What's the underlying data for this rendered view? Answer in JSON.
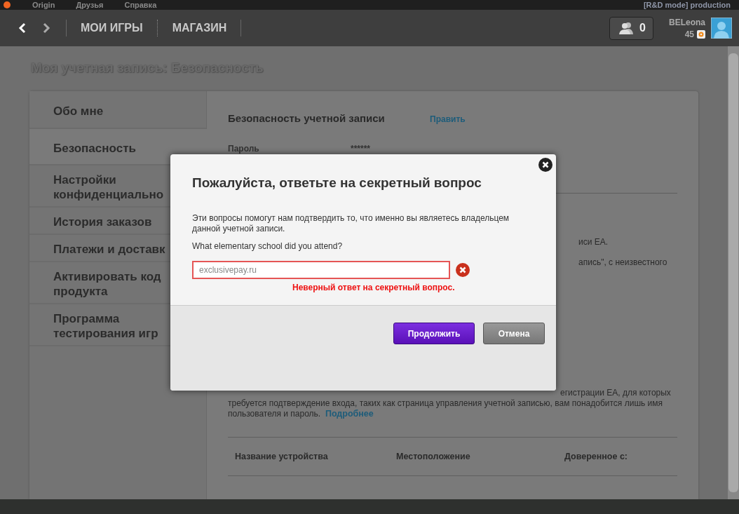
{
  "top_menu": {
    "items": [
      "Origin",
      "Друзья",
      "Справка"
    ],
    "mode_label": "[R&D mode] production"
  },
  "nav": {
    "links": [
      "МОИ ИГРЫ",
      "МАГАЗИН"
    ]
  },
  "friends": {
    "count": "0"
  },
  "user": {
    "name": "BELeona",
    "points": "45"
  },
  "page_title": "Моя учетная запись: Безопасность",
  "sidebar": {
    "items": [
      {
        "label": "Обо мне",
        "selected": false
      },
      {
        "label": "Безопасность",
        "selected": true
      },
      {
        "label": "Настройки конфиденциально",
        "selected": false
      },
      {
        "label": "История заказов",
        "selected": false
      },
      {
        "label": "Платежи и доставк",
        "selected": false
      },
      {
        "label": "Активировать код продукта",
        "selected": false
      },
      {
        "label": "Программа тестирования игр",
        "selected": false
      }
    ]
  },
  "security": {
    "title": "Безопасность учетной записи",
    "edit_link": "Править",
    "password_label": "Пароль",
    "password_value": "******",
    "fragments": [
      "иси EA.",
      "апись\", с неизвестного"
    ],
    "description_fragment": "егистрации EA, для которых",
    "description_lines": [
      "требуется подтверждение входа, таких как страница управления учетной записью, вам понадобится лишь имя",
      "пользователя и пароль."
    ],
    "more_link": "Подробнее",
    "table_columns": [
      "Название устройства",
      "Местоположение",
      "Доверенное с:"
    ]
  },
  "dialog": {
    "title": "Пожалуйста, ответьте на секретный вопрос",
    "description": "Эти вопросы помогут нам подтвердить то, что именно вы являетесь владельцем данной учетной записи.",
    "question": "What elementary school did you attend?",
    "answer": "exclusivepay.ru",
    "error": "Неверный ответ на секретный вопрос.",
    "buttons": [
      {
        "label": "Продолжить",
        "kind": "primary"
      },
      {
        "label": "Отмена",
        "kind": "secondary"
      }
    ]
  }
}
